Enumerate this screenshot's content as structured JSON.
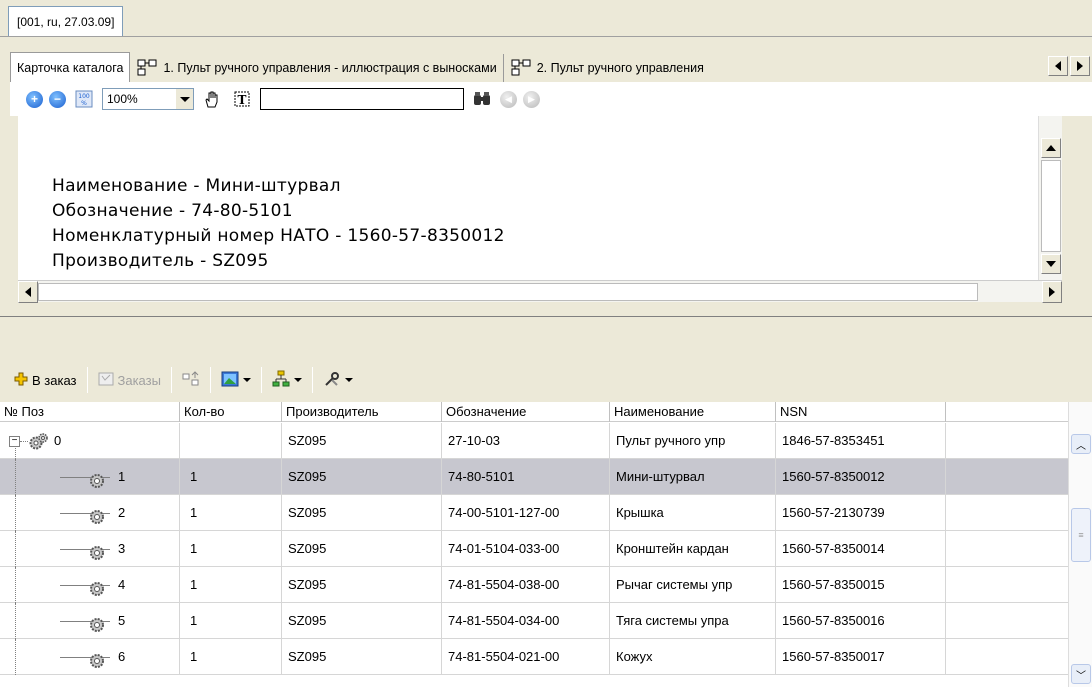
{
  "document_tab": "[001, ru, 27.03.09]",
  "tabs": [
    {
      "label": "Карточка каталога",
      "icon": "none",
      "active": true
    },
    {
      "label": "1. Пульт ручного управления - иллюстрация с выносками",
      "icon": "drawing-icon"
    },
    {
      "label": "2. Пульт ручного управления",
      "icon": "drawing-icon"
    }
  ],
  "viewer_toolbar": {
    "zoom": "100%",
    "search_value": ""
  },
  "viewer": {
    "lines": [
      "Наименование - Мини-штурвал",
      "Обозначение - 74-80-5101",
      "Номенклатурный номер НАТО - 1560-57-8350012",
      "Производитель - SZ095"
    ]
  },
  "list_toolbar": {
    "order_label": "В заказ",
    "orders_label": "Заказы"
  },
  "table": {
    "columns": [
      "№ Поз",
      "Кол-во",
      "Производитель",
      "Обозначение",
      "Наименование",
      "NSN",
      ""
    ],
    "rows": [
      {
        "pos": "0",
        "qty": "",
        "mfr": "SZ095",
        "code": "27-10-03",
        "name": "Пульт ручного упр",
        "nsn": "1846-57-8353451",
        "root": true
      },
      {
        "pos": "1",
        "qty": "1",
        "mfr": "SZ095",
        "code": "74-80-5101",
        "name": "Мини-штурвал",
        "nsn": "1560-57-8350012",
        "selected": true
      },
      {
        "pos": "2",
        "qty": "1",
        "mfr": "SZ095",
        "code": "74-00-5101-127-00",
        "name": "Крышка",
        "nsn": "1560-57-2130739"
      },
      {
        "pos": "3",
        "qty": "1",
        "mfr": "SZ095",
        "code": "74-01-5104-033-00",
        "name": "Кронштейн кардан",
        "nsn": "1560-57-8350014"
      },
      {
        "pos": "4",
        "qty": "1",
        "mfr": "SZ095",
        "code": "74-81-5504-038-00",
        "name": "Рычаг системы упр",
        "nsn": "1560-57-8350015"
      },
      {
        "pos": "5",
        "qty": "1",
        "mfr": "SZ095",
        "code": "74-81-5504-034-00",
        "name": "Тяга системы упра",
        "nsn": "1560-57-8350016"
      },
      {
        "pos": "6",
        "qty": "1",
        "mfr": "SZ095",
        "code": "74-81-5504-021-00",
        "name": "Кожух",
        "nsn": "1560-57-8350017"
      }
    ]
  },
  "colors": {
    "selected_row": "#c7c7cf",
    "accent_blue": "#1a5fcf"
  }
}
